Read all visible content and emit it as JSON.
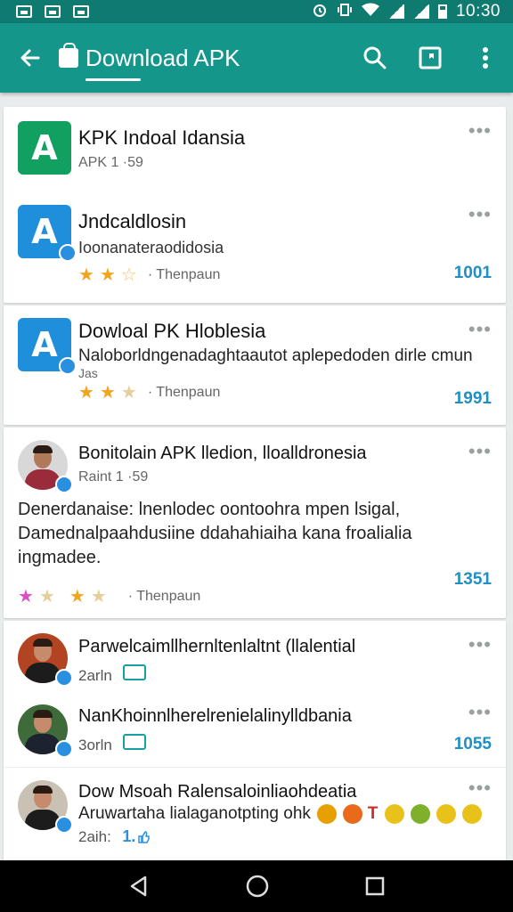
{
  "status_bar": {
    "time": "10:30"
  },
  "app_bar": {
    "title": "Download APK"
  },
  "items": [
    {
      "name": "KPK Indoal Idansia",
      "sub": "APK 1 ·59"
    },
    {
      "name": "Jndcaldlosin",
      "sub": "Ioonanateraodidosia",
      "rating_text": "· Thenpaun",
      "count": "1001"
    },
    {
      "name": "Dowloal PK Hloblesia",
      "sub": "Naloborldngenadaghtaautot aplepedoden dirle cmun",
      "extra": "Jas",
      "rating_text": "· Thenpaun",
      "count": "1991"
    },
    {
      "name": "Bonitolain APK lledion, lloalldronesia",
      "sub": "Raint 1 ·59",
      "desc_lines": [
        "Denerdanaise: lnenlodec oontoohra mpen lsigal,",
        "Damednalpaahdusiine ddahahiaiha kana froalialia",
        "ingmadee."
      ],
      "rating_text": "· Thenpaun",
      "count": "1351"
    },
    {
      "name": "Parwelcaimllhernltenlaltnt (llalential",
      "time": "2arln",
      "likes": ""
    },
    {
      "name": "NanKhoinnlherelrenielalinylldbania",
      "time": "3orln",
      "count": "1055"
    },
    {
      "name": "Dow Msoah Ralensaloinliaohdeatia",
      "desc": "Aruwartaha lialaganotpting ohk",
      "emoji_text": "T",
      "time": "2aih:",
      "likes": "1."
    }
  ],
  "colors": {
    "teal_dark": "#0f7a70",
    "teal": "#14968a",
    "accent_blue": "#1f8fc4",
    "star": "#f2a41c"
  }
}
